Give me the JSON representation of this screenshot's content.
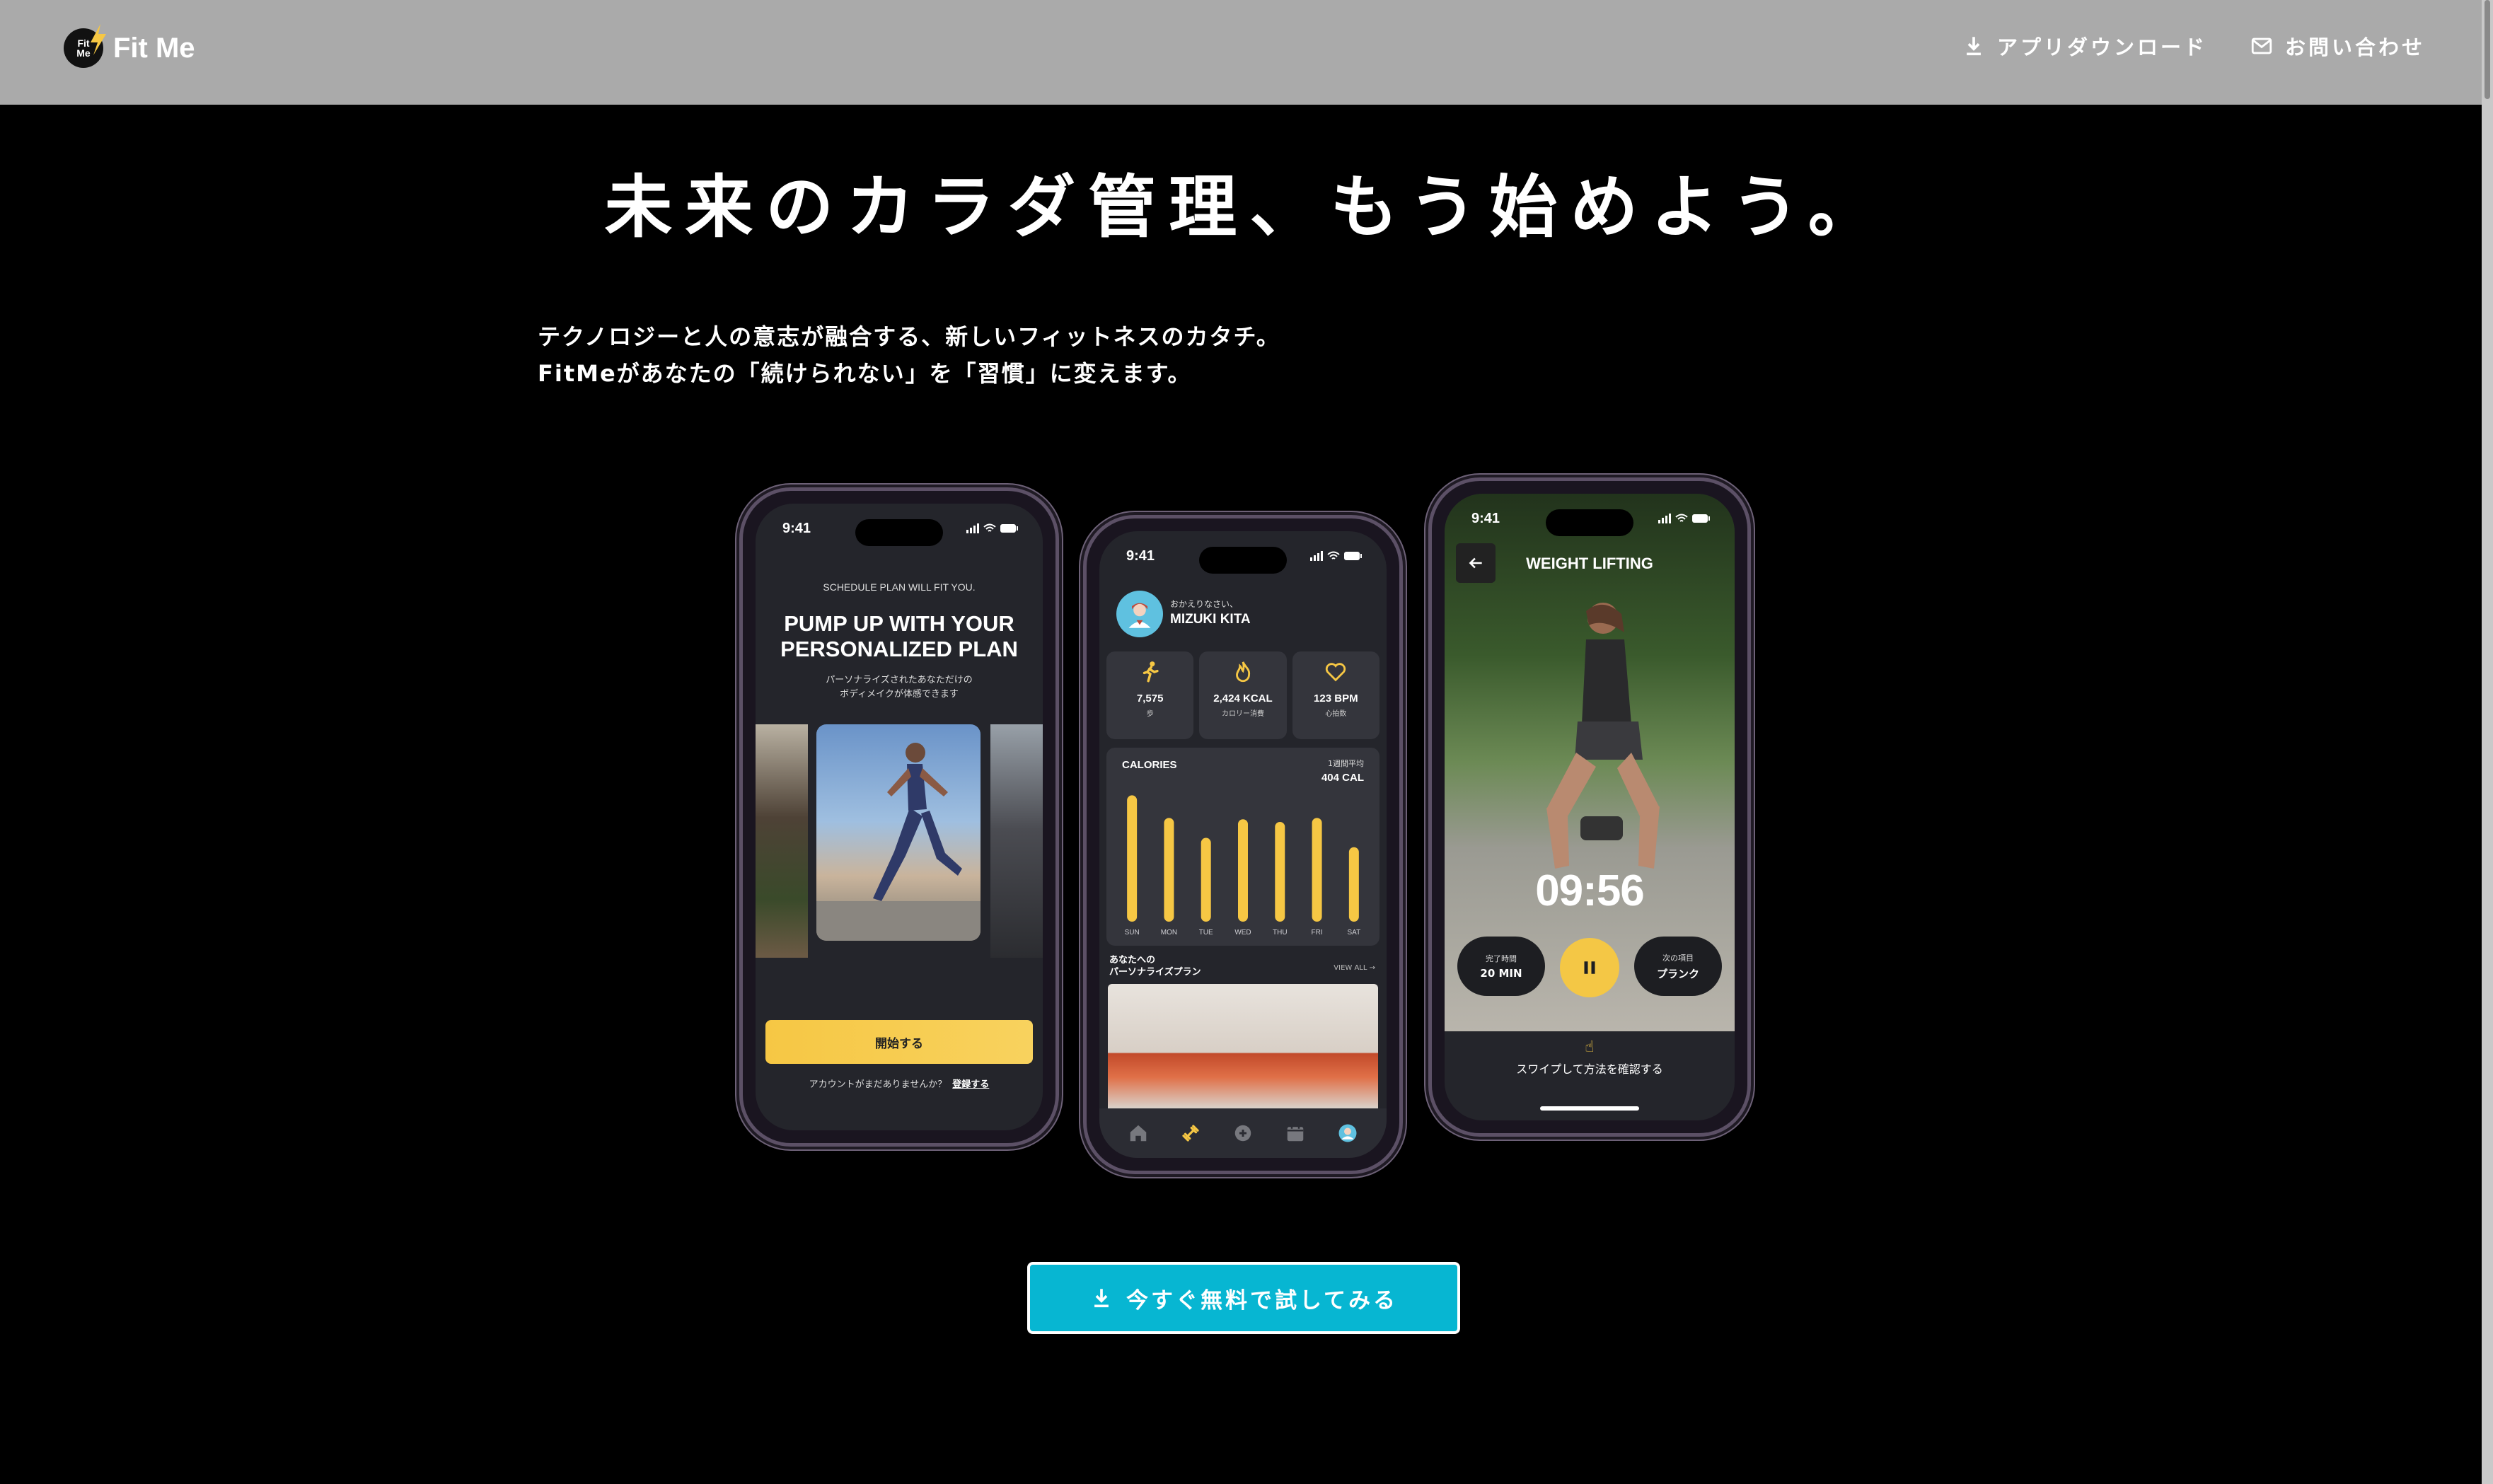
{
  "header": {
    "logo_badge": "Fit Me",
    "brand": "Fit Me",
    "nav": [
      {
        "label": "アプリダウンロード",
        "icon": "download-icon"
      },
      {
        "label": "お問い合わせ",
        "icon": "mail-icon"
      }
    ]
  },
  "hero": {
    "title": "未来のカラダ管理、もう始めよう。",
    "lead_line1": "テクノロジーと人の意志が融合する、新しいフィットネスのカタチ。",
    "lead_line2": "FitMeがあなたの「続けられない」を「習慣」に変えます。"
  },
  "phone1": {
    "time": "9:41",
    "eyebrow": "SCHEDULE PLAN WILL FIT YOU.",
    "heading_line1": "PUMP UP WITH YOUR",
    "heading_line2": "PERSONALIZED PLAN",
    "sub_line1": "パーソナライズされたあなただけの",
    "sub_line2": "ボディメイクが体感できます",
    "start_button": "開始する",
    "signup_prompt": "アカウントがまだありませんか？",
    "signup_link": "登録する"
  },
  "phone2": {
    "time": "9:41",
    "greeting": "おかえりなさい、",
    "user_name": "MIZUKI KITA",
    "stats": [
      {
        "value": "7,575",
        "label": "歩",
        "icon": "run-icon"
      },
      {
        "value": "2,424 KCAL",
        "label": "カロリー消費",
        "icon": "flame-icon"
      },
      {
        "value": "123 BPM",
        "label": "心拍数",
        "icon": "heart-icon"
      }
    ],
    "calories_title": "CALORIES",
    "weekly_avg_label": "1週間平均",
    "weekly_avg_value": "404 CAL",
    "plan_head_line1": "あなたへの",
    "plan_head_line2": "パーソナライズプラン",
    "view_all": "VIEW ALL →",
    "tabs": [
      "home-icon",
      "dumbbell-icon",
      "plus-icon",
      "calendar-icon",
      "profile-icon"
    ]
  },
  "chart_data": {
    "type": "bar",
    "categories": [
      "SUN",
      "MON",
      "TUE",
      "WED",
      "THU",
      "FRI",
      "SAT"
    ],
    "values": [
      95,
      78,
      63,
      77,
      75,
      78,
      56
    ],
    "title": "CALORIES"
  },
  "phone3": {
    "time": "9:41",
    "title": "WEIGHT LIFTING",
    "timer": "09:56",
    "left_pill_label": "完了時間",
    "left_pill_value": "20 MIN",
    "right_pill_label": "次の項目",
    "right_pill_value": "プランク",
    "swipe_hint": "スワイプして方法を確認する"
  },
  "cta": {
    "label": "今すぐ無料で試してみる",
    "icon": "download-icon"
  },
  "colors": {
    "accent": "#07b6d2",
    "yellow": "#f6c744",
    "header_bg": "#aaaaaa"
  }
}
